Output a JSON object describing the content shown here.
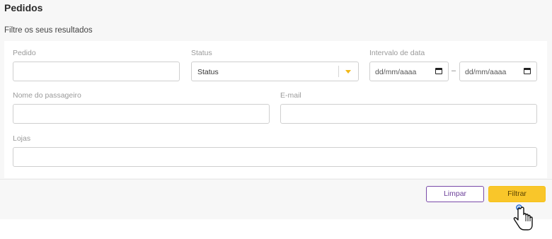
{
  "page": {
    "title": "Pedidos",
    "subtitle": "Filtre os seus resultados"
  },
  "filters": {
    "pedido": {
      "label": "Pedido",
      "value": ""
    },
    "status": {
      "label": "Status",
      "selected": "Status"
    },
    "date_range": {
      "label": "Intervalo de data",
      "from": "dd/mm/aaaa",
      "to": "dd/mm/aaaa",
      "separator": "–"
    },
    "passenger": {
      "label": "Nome do passageiro",
      "value": ""
    },
    "email": {
      "label": "E-mail",
      "value": ""
    },
    "stores": {
      "label": "Lojas",
      "value": ""
    }
  },
  "actions": {
    "clear_label": "Limpar",
    "filter_label": "Filtrar"
  },
  "colors": {
    "accent": "#f9c62a",
    "secondary": "#7a4aa8"
  }
}
